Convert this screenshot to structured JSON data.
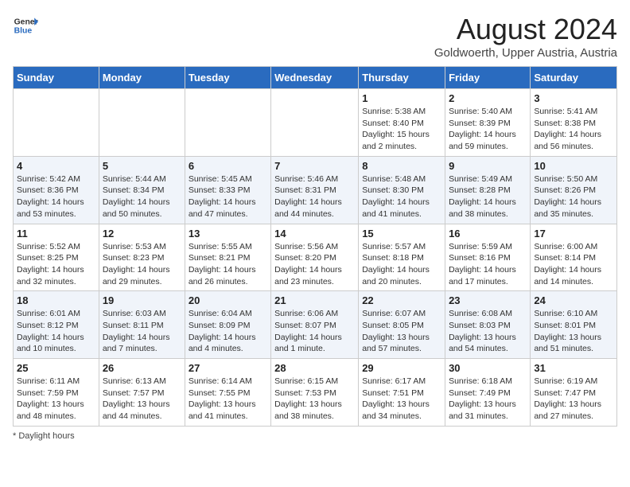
{
  "logo": {
    "general": "General",
    "blue": "Blue"
  },
  "title": "August 2024",
  "subtitle": "Goldwoerth, Upper Austria, Austria",
  "days_of_week": [
    "Sunday",
    "Monday",
    "Tuesday",
    "Wednesday",
    "Thursday",
    "Friday",
    "Saturday"
  ],
  "footer": "Daylight hours",
  "weeks": [
    [
      {
        "day": "",
        "info": ""
      },
      {
        "day": "",
        "info": ""
      },
      {
        "day": "",
        "info": ""
      },
      {
        "day": "",
        "info": ""
      },
      {
        "day": "1",
        "info": "Sunrise: 5:38 AM\nSunset: 8:40 PM\nDaylight: 15 hours\nand 2 minutes."
      },
      {
        "day": "2",
        "info": "Sunrise: 5:40 AM\nSunset: 8:39 PM\nDaylight: 14 hours\nand 59 minutes."
      },
      {
        "day": "3",
        "info": "Sunrise: 5:41 AM\nSunset: 8:38 PM\nDaylight: 14 hours\nand 56 minutes."
      }
    ],
    [
      {
        "day": "4",
        "info": "Sunrise: 5:42 AM\nSunset: 8:36 PM\nDaylight: 14 hours\nand 53 minutes."
      },
      {
        "day": "5",
        "info": "Sunrise: 5:44 AM\nSunset: 8:34 PM\nDaylight: 14 hours\nand 50 minutes."
      },
      {
        "day": "6",
        "info": "Sunrise: 5:45 AM\nSunset: 8:33 PM\nDaylight: 14 hours\nand 47 minutes."
      },
      {
        "day": "7",
        "info": "Sunrise: 5:46 AM\nSunset: 8:31 PM\nDaylight: 14 hours\nand 44 minutes."
      },
      {
        "day": "8",
        "info": "Sunrise: 5:48 AM\nSunset: 8:30 PM\nDaylight: 14 hours\nand 41 minutes."
      },
      {
        "day": "9",
        "info": "Sunrise: 5:49 AM\nSunset: 8:28 PM\nDaylight: 14 hours\nand 38 minutes."
      },
      {
        "day": "10",
        "info": "Sunrise: 5:50 AM\nSunset: 8:26 PM\nDaylight: 14 hours\nand 35 minutes."
      }
    ],
    [
      {
        "day": "11",
        "info": "Sunrise: 5:52 AM\nSunset: 8:25 PM\nDaylight: 14 hours\nand 32 minutes."
      },
      {
        "day": "12",
        "info": "Sunrise: 5:53 AM\nSunset: 8:23 PM\nDaylight: 14 hours\nand 29 minutes."
      },
      {
        "day": "13",
        "info": "Sunrise: 5:55 AM\nSunset: 8:21 PM\nDaylight: 14 hours\nand 26 minutes."
      },
      {
        "day": "14",
        "info": "Sunrise: 5:56 AM\nSunset: 8:20 PM\nDaylight: 14 hours\nand 23 minutes."
      },
      {
        "day": "15",
        "info": "Sunrise: 5:57 AM\nSunset: 8:18 PM\nDaylight: 14 hours\nand 20 minutes."
      },
      {
        "day": "16",
        "info": "Sunrise: 5:59 AM\nSunset: 8:16 PM\nDaylight: 14 hours\nand 17 minutes."
      },
      {
        "day": "17",
        "info": "Sunrise: 6:00 AM\nSunset: 8:14 PM\nDaylight: 14 hours\nand 14 minutes."
      }
    ],
    [
      {
        "day": "18",
        "info": "Sunrise: 6:01 AM\nSunset: 8:12 PM\nDaylight: 14 hours\nand 10 minutes."
      },
      {
        "day": "19",
        "info": "Sunrise: 6:03 AM\nSunset: 8:11 PM\nDaylight: 14 hours\nand 7 minutes."
      },
      {
        "day": "20",
        "info": "Sunrise: 6:04 AM\nSunset: 8:09 PM\nDaylight: 14 hours\nand 4 minutes."
      },
      {
        "day": "21",
        "info": "Sunrise: 6:06 AM\nSunset: 8:07 PM\nDaylight: 14 hours\nand 1 minute."
      },
      {
        "day": "22",
        "info": "Sunrise: 6:07 AM\nSunset: 8:05 PM\nDaylight: 13 hours\nand 57 minutes."
      },
      {
        "day": "23",
        "info": "Sunrise: 6:08 AM\nSunset: 8:03 PM\nDaylight: 13 hours\nand 54 minutes."
      },
      {
        "day": "24",
        "info": "Sunrise: 6:10 AM\nSunset: 8:01 PM\nDaylight: 13 hours\nand 51 minutes."
      }
    ],
    [
      {
        "day": "25",
        "info": "Sunrise: 6:11 AM\nSunset: 7:59 PM\nDaylight: 13 hours\nand 48 minutes."
      },
      {
        "day": "26",
        "info": "Sunrise: 6:13 AM\nSunset: 7:57 PM\nDaylight: 13 hours\nand 44 minutes."
      },
      {
        "day": "27",
        "info": "Sunrise: 6:14 AM\nSunset: 7:55 PM\nDaylight: 13 hours\nand 41 minutes."
      },
      {
        "day": "28",
        "info": "Sunrise: 6:15 AM\nSunset: 7:53 PM\nDaylight: 13 hours\nand 38 minutes."
      },
      {
        "day": "29",
        "info": "Sunrise: 6:17 AM\nSunset: 7:51 PM\nDaylight: 13 hours\nand 34 minutes."
      },
      {
        "day": "30",
        "info": "Sunrise: 6:18 AM\nSunset: 7:49 PM\nDaylight: 13 hours\nand 31 minutes."
      },
      {
        "day": "31",
        "info": "Sunrise: 6:19 AM\nSunset: 7:47 PM\nDaylight: 13 hours\nand 27 minutes."
      }
    ]
  ]
}
